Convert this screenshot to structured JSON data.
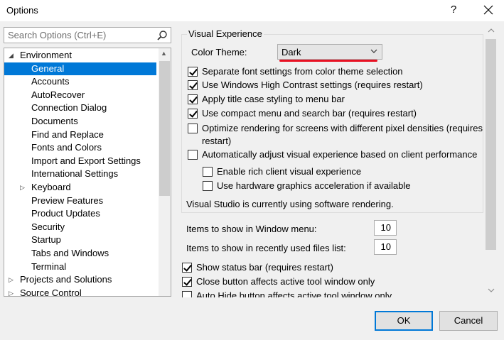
{
  "window": {
    "title": "Options",
    "help_label": "?"
  },
  "search": {
    "placeholder": "Search Options (Ctrl+E)"
  },
  "tree": {
    "items": [
      {
        "label": "Environment",
        "expanded": true,
        "selected": false
      },
      {
        "label": "General",
        "selected": true
      },
      {
        "label": "Accounts"
      },
      {
        "label": "AutoRecover"
      },
      {
        "label": "Connection Dialog"
      },
      {
        "label": "Documents"
      },
      {
        "label": "Find and Replace"
      },
      {
        "label": "Fonts and Colors"
      },
      {
        "label": "Import and Export Settings"
      },
      {
        "label": "International Settings"
      },
      {
        "label": "Keyboard",
        "expandable": true
      },
      {
        "label": "Preview Features"
      },
      {
        "label": "Product Updates"
      },
      {
        "label": "Security"
      },
      {
        "label": "Startup"
      },
      {
        "label": "Tabs and Windows"
      },
      {
        "label": "Terminal"
      },
      {
        "label": "Projects and Solutions",
        "expandable": true
      },
      {
        "label": "Source Control",
        "expandable": true
      }
    ]
  },
  "visual_experience": {
    "group_label": "Visual Experience",
    "color_theme_label": "Color Theme:",
    "color_theme_value": "Dark",
    "options": [
      {
        "label": "Separate font settings from color theme selection",
        "checked": true
      },
      {
        "label": "Use Windows High Contrast settings (requires restart)",
        "checked": true
      },
      {
        "label": "Apply title case styling to menu bar",
        "checked": true
      },
      {
        "label": "Use compact menu and search bar (requires restart)",
        "checked": true
      },
      {
        "label": "Optimize rendering for screens with different pixel densities (requires",
        "label_line2": "restart)",
        "checked": false
      },
      {
        "label": "Automatically adjust visual experience based on client performance",
        "checked": false
      }
    ],
    "sub_options": [
      {
        "label": "Enable rich client visual experience",
        "checked": false
      },
      {
        "label": "Use hardware graphics acceleration if available",
        "checked": false
      }
    ],
    "status_text": "Visual Studio is currently using software rendering."
  },
  "numbers": {
    "window_menu_label": "Items to show in Window menu:",
    "window_menu_value": "10",
    "recent_files_label": "Items to show in recently used files list:",
    "recent_files_value": "10"
  },
  "more_options": [
    {
      "label": "Show status bar (requires restart)",
      "checked": true
    },
    {
      "label": "Close button affects active tool window only",
      "checked": true
    },
    {
      "label": "Auto Hide button affects active tool window only",
      "checked": false
    }
  ],
  "buttons": {
    "ok": "OK",
    "cancel": "Cancel"
  },
  "colors": {
    "accent": "#0078d7",
    "highlight_underline": "#e81123"
  }
}
